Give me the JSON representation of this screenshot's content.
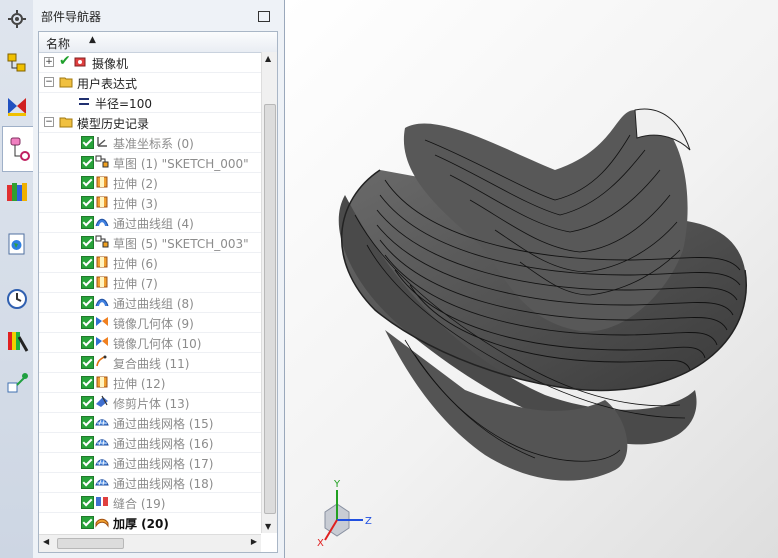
{
  "navigator": {
    "title": "部件导航器",
    "column_header": "名称",
    "tree": [
      {
        "label": "摄像机",
        "check": "green",
        "dim": false,
        "bold": false,
        "icon": "camera-icon",
        "level": 0
      },
      {
        "label": "用户表达式",
        "check": "none",
        "dim": false,
        "bold": false,
        "icon": "folder-icon",
        "level": 0
      },
      {
        "label": "半径=100",
        "check": "none",
        "dim": false,
        "bold": false,
        "icon": "equals-icon",
        "level": 1
      },
      {
        "label": "模型历史记录",
        "check": "none",
        "dim": false,
        "bold": false,
        "icon": "folder-icon",
        "level": 0
      },
      {
        "label": "基准坐标系 (0)",
        "check": "box",
        "dim": true,
        "bold": false,
        "icon": "datum-csys-icon",
        "level": 1
      },
      {
        "label": "草图 (1) \"SKETCH_000\"",
        "check": "box",
        "dim": true,
        "bold": false,
        "icon": "sketch-icon",
        "level": 1
      },
      {
        "label": "拉伸 (2)",
        "check": "box",
        "dim": true,
        "bold": false,
        "icon": "extrude-icon",
        "level": 1
      },
      {
        "label": "拉伸 (3)",
        "check": "box",
        "dim": true,
        "bold": false,
        "icon": "extrude-icon",
        "level": 1
      },
      {
        "label": "通过曲线组 (4)",
        "check": "box",
        "dim": true,
        "bold": false,
        "icon": "through-curves-icon",
        "level": 1
      },
      {
        "label": "草图 (5) \"SKETCH_003\"",
        "check": "box",
        "dim": true,
        "bold": false,
        "icon": "sketch-icon",
        "level": 1
      },
      {
        "label": "拉伸 (6)",
        "check": "box",
        "dim": true,
        "bold": false,
        "icon": "extrude-icon",
        "level": 1
      },
      {
        "label": "拉伸 (7)",
        "check": "box",
        "dim": true,
        "bold": false,
        "icon": "extrude-icon",
        "level": 1
      },
      {
        "label": "通过曲线组 (8)",
        "check": "box",
        "dim": true,
        "bold": false,
        "icon": "through-curves-icon",
        "level": 1
      },
      {
        "label": "镜像几何体 (9)",
        "check": "box",
        "dim": true,
        "bold": false,
        "icon": "mirror-icon",
        "level": 1
      },
      {
        "label": "镜像几何体 (10)",
        "check": "box",
        "dim": true,
        "bold": false,
        "icon": "mirror-icon",
        "level": 1
      },
      {
        "label": "复合曲线 (11)",
        "check": "box",
        "dim": true,
        "bold": false,
        "icon": "composite-curve-icon",
        "level": 1
      },
      {
        "label": "拉伸 (12)",
        "check": "box",
        "dim": true,
        "bold": false,
        "icon": "extrude-icon",
        "level": 1
      },
      {
        "label": "修剪片体 (13)",
        "check": "box",
        "dim": true,
        "bold": false,
        "icon": "trim-sheet-icon",
        "level": 1
      },
      {
        "label": "通过曲线网格 (15)",
        "check": "box",
        "dim": true,
        "bold": false,
        "icon": "curve-mesh-icon",
        "level": 1
      },
      {
        "label": "通过曲线网格 (16)",
        "check": "box",
        "dim": true,
        "bold": false,
        "icon": "curve-mesh-icon",
        "level": 1
      },
      {
        "label": "通过曲线网格 (17)",
        "check": "box",
        "dim": true,
        "bold": false,
        "icon": "curve-mesh-icon",
        "level": 1
      },
      {
        "label": "通过曲线网格 (18)",
        "check": "box",
        "dim": true,
        "bold": false,
        "icon": "curve-mesh-icon",
        "level": 1
      },
      {
        "label": "缝合 (19)",
        "check": "box",
        "dim": true,
        "bold": false,
        "icon": "sew-icon",
        "level": 1
      },
      {
        "label": "加厚 (20)",
        "check": "box",
        "dim": false,
        "bold": true,
        "icon": "thicken-icon",
        "level": 1
      }
    ]
  },
  "leftbar": {
    "icons": [
      "gear-icon",
      "assembly-navigator-icon",
      "constraint-navigator-icon",
      "part-navigator-icon",
      "reuse-library-icon",
      "web-browser-icon",
      "history-icon",
      "system-materials-icon",
      "process-studio-icon"
    ]
  },
  "viewport": {
    "triad": {
      "x": "X",
      "y": "Y",
      "z": "Z"
    }
  },
  "colors": {
    "check_green": "#27a33a",
    "model_gray": "#5b5b5b",
    "axis_x": "#e02020",
    "axis_y": "#20a020",
    "axis_z": "#2050e0"
  }
}
